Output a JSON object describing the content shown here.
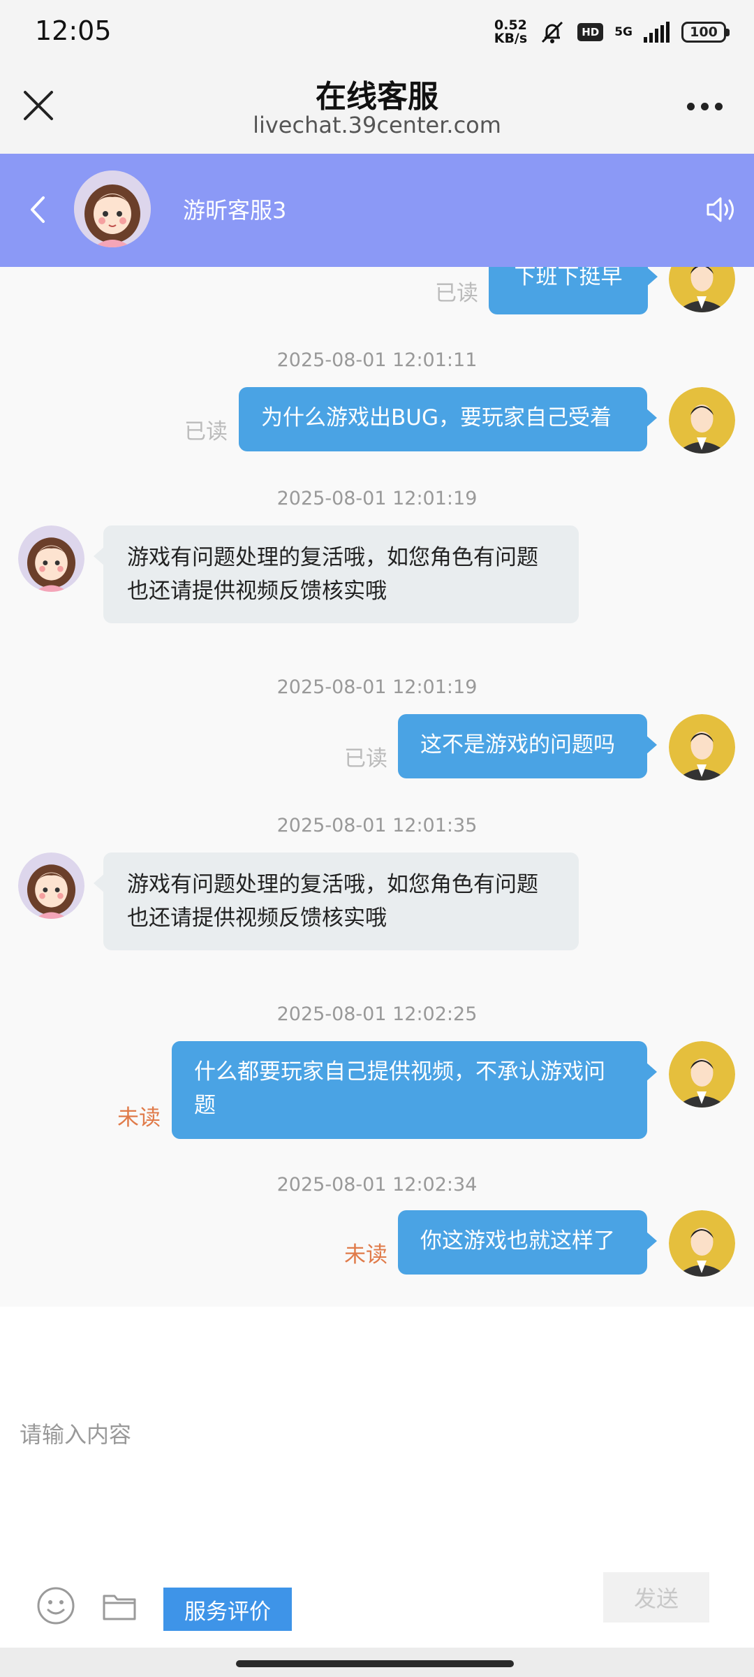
{
  "status_bar": {
    "time": "12:05",
    "net_speed_value": "0.52",
    "net_speed_unit": "KB/s",
    "hd": "HD",
    "network": "5G",
    "battery": "100"
  },
  "browser": {
    "title": "在线客服",
    "url": "livechat.39center.com"
  },
  "chat_header": {
    "agent_name": "游昕客服3"
  },
  "messages": [
    {
      "direction": "out",
      "text": "下班下挺早",
      "status": "已读"
    },
    {
      "timestamp": "2025-08-01 12:01:11",
      "direction": "out",
      "text": "为什么游戏出BUG，要玩家自己受着",
      "status": "已读"
    },
    {
      "timestamp": "2025-08-01 12:01:19",
      "direction": "in",
      "text": "游戏有问题处理的复活哦，如您角色有问题也还请提供视频反馈核实哦"
    },
    {
      "timestamp": "2025-08-01 12:01:19",
      "direction": "out",
      "text": "这不是游戏的问题吗",
      "status": "已读"
    },
    {
      "timestamp": "2025-08-01 12:01:35",
      "direction": "in",
      "text": "游戏有问题处理的复活哦，如您角色有问题也还请提供视频反馈核实哦"
    },
    {
      "timestamp": "2025-08-01 12:02:25",
      "direction": "out",
      "text": "什么都要玩家自己提供视频，不承认游戏问题",
      "status": "未读"
    },
    {
      "timestamp": "2025-08-01 12:02:34",
      "direction": "out",
      "text": "你这游戏也就这样了",
      "status": "未读"
    }
  ],
  "input": {
    "placeholder": "请输入内容",
    "rate_label": "服务评价",
    "send_label": "发送"
  },
  "colors": {
    "header_bg": "#8b99f6",
    "bubble_out": "#4aa3e4",
    "bubble_in": "#e9edef",
    "unread": "#e07b4a",
    "rate_button": "#3e94e8"
  }
}
